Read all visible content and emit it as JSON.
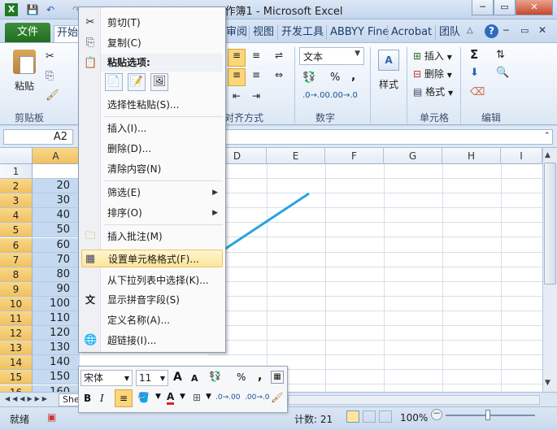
{
  "window": {
    "title": "工作簿1 - Microsoft Excel"
  },
  "quick_access": {
    "save": "💾",
    "undo": "↶",
    "redo": "↷"
  },
  "window_buttons": {
    "minimize": "─",
    "restore": "▭",
    "close": "✕"
  },
  "tabs": {
    "file": "文件",
    "items": [
      "开始",
      "审阅",
      "视图",
      "开发工具",
      "ABBYY Fine",
      "Acrobat",
      "团队"
    ],
    "help": "?"
  },
  "ribbon": {
    "clipboard": {
      "paste": "粘贴",
      "label": "剪贴板"
    },
    "alignment": {
      "label": "对齐方式"
    },
    "number": {
      "format_value": "文本",
      "percent": "%",
      "comma": ",",
      "label": "数字"
    },
    "styles": {
      "label": "样式"
    },
    "cells": {
      "insert": "插入",
      "delete": "删除",
      "format": "格式",
      "label": "单元格"
    },
    "editing": {
      "sum": "Σ",
      "label": "编辑"
    }
  },
  "formula_bar": {
    "name_box": "A2"
  },
  "grid": {
    "columns": [
      "A",
      "D",
      "E",
      "F",
      "G",
      "H",
      "I"
    ],
    "rows": [
      "1",
      "2",
      "3",
      "4",
      "5",
      "6",
      "7",
      "8",
      "9",
      "10",
      "11",
      "12",
      "13",
      "14",
      "15",
      "16"
    ],
    "values": [
      "",
      "20",
      "30",
      "40",
      "50",
      "60",
      "70",
      "80",
      "90",
      "100",
      "110",
      "120",
      "130",
      "140",
      "150",
      "160"
    ]
  },
  "sheet_tab": "She",
  "status": {
    "ready": "就绪",
    "count": "计数: 21",
    "zoom": "100%",
    "minus": "－"
  },
  "context_menu": {
    "items": [
      {
        "label": "剪切(T)",
        "icon": "scissors-icon"
      },
      {
        "label": "复制(C)",
        "icon": "copy-icon"
      },
      {
        "label": "粘贴选项:",
        "icon": "paste-icon"
      },
      {
        "label": "选择性粘贴(S)..."
      },
      {
        "label": "插入(I)..."
      },
      {
        "label": "删除(D)..."
      },
      {
        "label": "清除内容(N)"
      },
      {
        "label": "筛选(E)"
      },
      {
        "label": "排序(O)"
      },
      {
        "label": "插入批注(M)",
        "icon": "comment-icon"
      },
      {
        "label": "设置单元格格式(F)...",
        "icon": "format-cells-icon"
      },
      {
        "label": "从下拉列表中选择(K)..."
      },
      {
        "label": "显示拼音字段(S)",
        "icon": "phonetic-icon"
      },
      {
        "label": "定义名称(A)..."
      },
      {
        "label": "超链接(I)...",
        "icon": "hyperlink-icon"
      }
    ],
    "phonetic_glyph": "文"
  },
  "mini_toolbar": {
    "font": "宋体",
    "size": "11",
    "grow": "A",
    "shrink": "A",
    "percent": "%",
    "comma": ",",
    "bold": "B",
    "italic": "I",
    "align": "≡",
    "decimal_increase": ".0→.00",
    "decimal_decrease": ".00→.0"
  },
  "colors": {
    "accent": "#1a73c8",
    "arrow": "#29a3e0",
    "file_tab": "#2a7a2a",
    "highlight": "#fde59a"
  }
}
